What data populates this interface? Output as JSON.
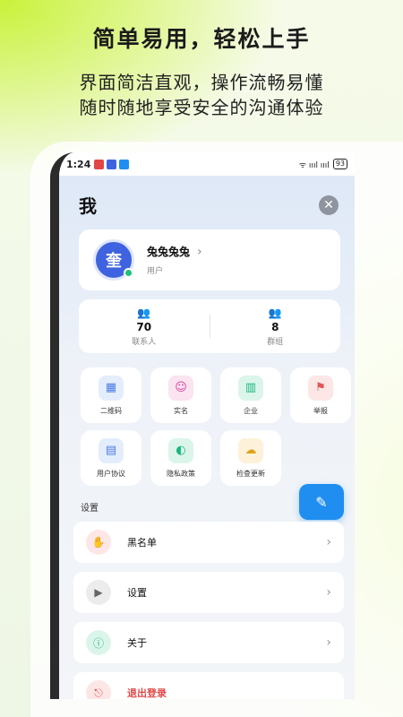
{
  "promo": {
    "headline": "简单易用，轻松上手",
    "line1": "界面简洁直观，操作流畅易懂",
    "line2": "随时随地享受安全的沟通体验"
  },
  "statusbar": {
    "time": "1:24",
    "signal": "ᯤ ıııl ıııl",
    "battery": "93"
  },
  "page": {
    "title": "我",
    "close_icon": "✕"
  },
  "profile": {
    "avatar_text": "奎",
    "name": "兔兔兔兔",
    "role": "用户",
    "chevron": "›"
  },
  "stats": [
    {
      "icon": "contacts-icon",
      "glyph": "👥",
      "value": "70",
      "label": "联系人"
    },
    {
      "icon": "groups-icon",
      "glyph": "👥",
      "value": "8",
      "label": "群组"
    }
  ],
  "tiles": [
    {
      "label": "二维码",
      "icon": "qrcode-icon",
      "glyph": "▦",
      "color": "#4d7be6",
      "bg": "#e4edfb"
    },
    {
      "label": "实名",
      "icon": "realname-icon",
      "glyph": "☺",
      "color": "#d6409b",
      "bg": "#fbe3ef"
    },
    {
      "label": "企业",
      "icon": "enterprise-icon",
      "glyph": "▥",
      "color": "#19b67f",
      "bg": "#dcf5ea"
    },
    {
      "label": "举报",
      "icon": "report-flag-icon",
      "glyph": "⚑",
      "color": "#e25555",
      "bg": "#fde6e6"
    },
    {
      "label": "用户协议",
      "icon": "agreement-icon",
      "glyph": "▤",
      "color": "#4d7be6",
      "bg": "#e4edfb"
    },
    {
      "label": "隐私政策",
      "icon": "privacy-shield-icon",
      "glyph": "◐",
      "color": "#19b67f",
      "bg": "#dcf5ea"
    },
    {
      "label": "检查更新",
      "icon": "update-cloud-icon",
      "glyph": "☁",
      "color": "#e0a21c",
      "bg": "#fdf1d9"
    }
  ],
  "settings_section": {
    "title": "设置",
    "fab_glyph": "✎"
  },
  "rows": [
    {
      "label": "黑名单",
      "icon": "blacklist-hand-icon",
      "glyph": "✋",
      "color": "#e25555",
      "bg": "#fde6e6"
    },
    {
      "label": "设置",
      "icon": "settings-icon",
      "glyph": "▶",
      "color": "#666666",
      "bg": "#ececec"
    },
    {
      "label": "关于",
      "icon": "about-info-icon",
      "glyph": "ⓘ",
      "color": "#19b67f",
      "bg": "#dcf5ea"
    },
    {
      "label": "退出登录",
      "icon": "logout-icon",
      "glyph": "⎋",
      "color": "#e25555",
      "bg": "#fde6e6"
    }
  ]
}
